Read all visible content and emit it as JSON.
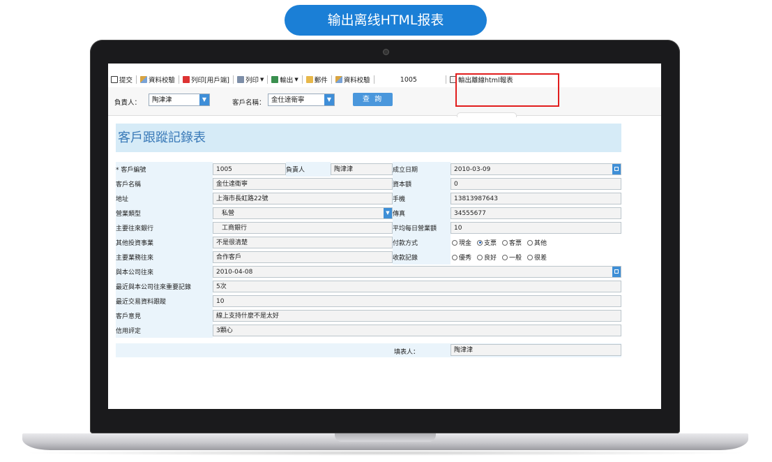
{
  "banner": {
    "title": "输出离线HTML报表"
  },
  "toolbar": {
    "items": [
      {
        "label": "提交",
        "icon": "submit-icon"
      },
      {
        "label": "資料校驗",
        "icon": "check-icon"
      },
      {
        "label": "列印[用戶端]",
        "icon": "print-client-icon"
      },
      {
        "label": "列印",
        "icon": "print-icon",
        "dropdown": true
      },
      {
        "label": "輸出",
        "icon": "export-icon",
        "dropdown": true
      },
      {
        "label": "郵件",
        "icon": "mail-icon"
      },
      {
        "label": "資料校驗",
        "icon": "check-icon"
      }
    ],
    "record_number": "1005",
    "export_offline_label": "輸出離線html報表"
  },
  "filter": {
    "owner_label": "負責人：",
    "owner_value": "陶津津",
    "customer_label": "客戶名稱：",
    "customer_value": "金仕達衛寧",
    "query_button": "查 詢"
  },
  "form": {
    "title": "客戶跟蹤記錄表",
    "customer_no_label": "* 客戶編號",
    "customer_no": "1005",
    "owner_label": "負責人",
    "owner": "陶津津",
    "established_label": "成立日期",
    "established": "2010-03-09",
    "customer_name_label": "客戶名稱",
    "customer_name": "金仕達衛寧",
    "capital_label": "資本額",
    "capital": "0",
    "address_label": "地址",
    "address": "上海市長虹路22號",
    "mobile_label": "手機",
    "mobile": "13813987643",
    "business_type_label": "營業類型",
    "business_type": "私營",
    "fax_label": "傳真",
    "fax": "34555677",
    "bank_label": "主要往來銀行",
    "bank": "工商銀行",
    "daily_revenue_label": "平均每日營業額",
    "daily_revenue": "10",
    "other_invest_label": "其他投資事業",
    "other_invest": "不是很清楚",
    "payment_label": "付款方式",
    "payment_options": [
      {
        "label": "現金",
        "selected": false
      },
      {
        "label": "支票",
        "selected": true
      },
      {
        "label": "客票",
        "selected": false
      },
      {
        "label": "其他",
        "selected": false
      }
    ],
    "main_business_label": "主要業務往來",
    "main_business": "合作客戶",
    "collection_label": "收款記錄",
    "collection_options": [
      {
        "label": "優秀",
        "selected": false
      },
      {
        "label": "良好",
        "selected": false
      },
      {
        "label": "一般",
        "selected": false
      },
      {
        "label": "很差",
        "selected": false
      }
    ],
    "since_label": "與本公司往來",
    "since": "2010-04-08",
    "important_label": "最近與本公司往來重要記錄",
    "important": "5次",
    "recent_trade_label": "最近交易資料跟蹤",
    "recent_trade": "10",
    "opinion_label": "客戶意見",
    "opinion": "線上支持什麼不是太好",
    "credit_label": "信用評定",
    "credit": "3顆心",
    "filler_label": "填表人：",
    "filler": "陶津津"
  },
  "colors": {
    "accent": "#1b7fd6",
    "highlight": "#e11d1d",
    "form_bg": "#eaf4fb"
  }
}
